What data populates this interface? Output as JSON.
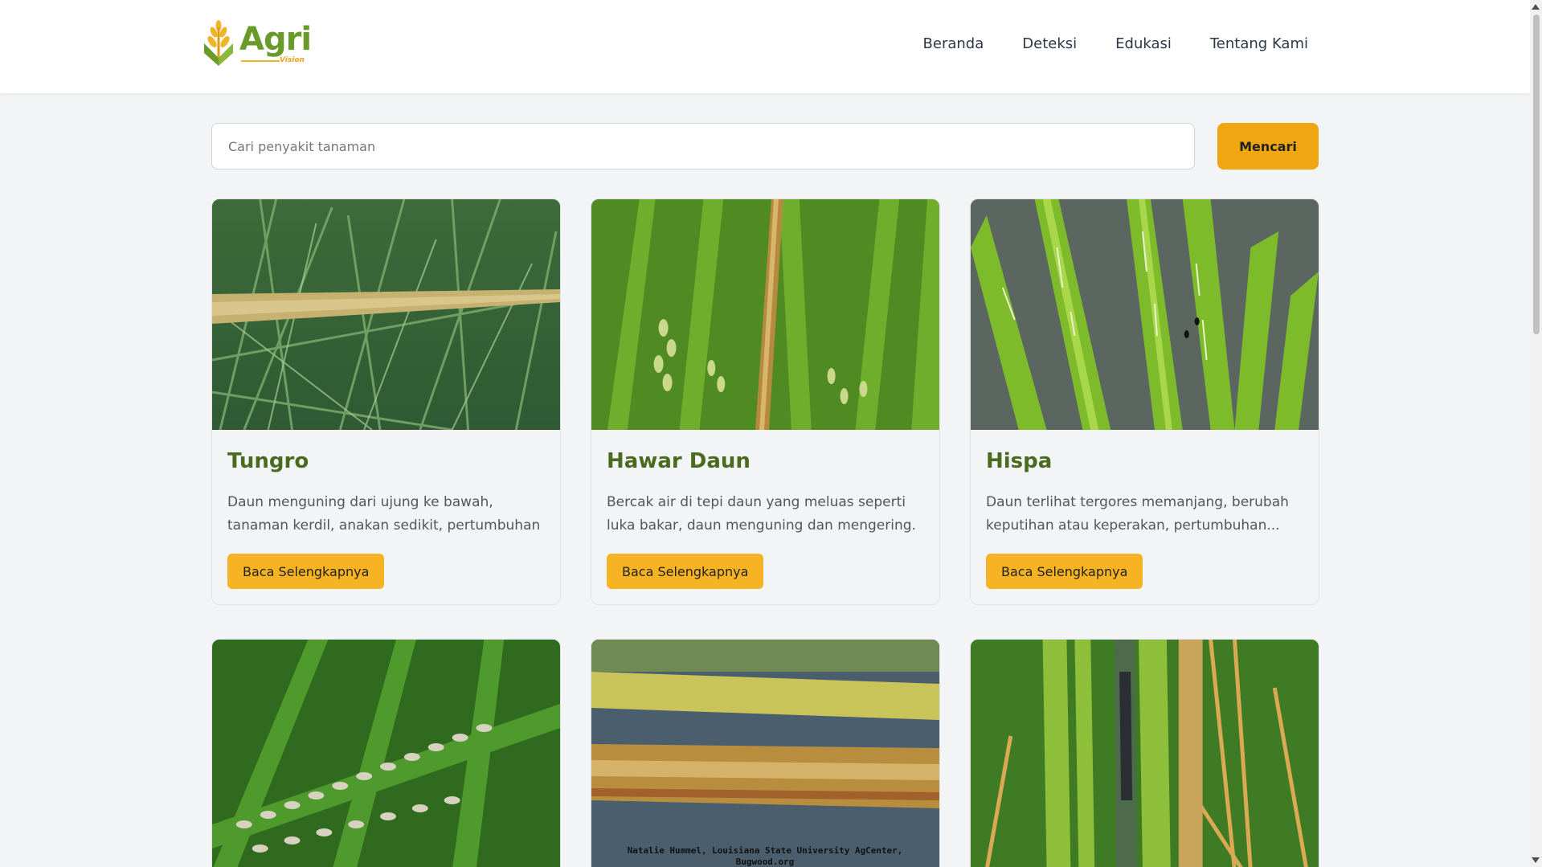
{
  "brand": {
    "name": "Agri",
    "sub": "Vision"
  },
  "nav": {
    "items": [
      "Beranda",
      "Deteksi",
      "Edukasi",
      "Tentang Kami"
    ]
  },
  "search": {
    "placeholder": "Cari penyakit tanaman",
    "value": "",
    "button_label": "Mencari"
  },
  "cards": [
    {
      "title": "Tungro",
      "description": "Daun menguning dari ujung ke bawah, tanaman kerdil, anakan sedikit, pertumbuhan tidak...",
      "button_label": "Baca Selengkapnya"
    },
    {
      "title": "Hawar Daun",
      "description": "Bercak air di tepi daun yang meluas seperti luka bakar, daun menguning dan mengering.",
      "button_label": "Baca Selengkapnya"
    },
    {
      "title": "Hispa",
      "description": "Daun terlihat tergores memanjang, berubah keputihan atau keperakan, pertumbuhan...",
      "button_label": "Baca Selengkapnya"
    }
  ],
  "row2_credit": {
    "line1": "Natalie Hummel, Louisiana State University AgCenter,",
    "line2": "Bugwood.org"
  },
  "colors": {
    "accent": "#f0a611",
    "button": "#f6b424",
    "title_green": "#4a6b1f"
  }
}
